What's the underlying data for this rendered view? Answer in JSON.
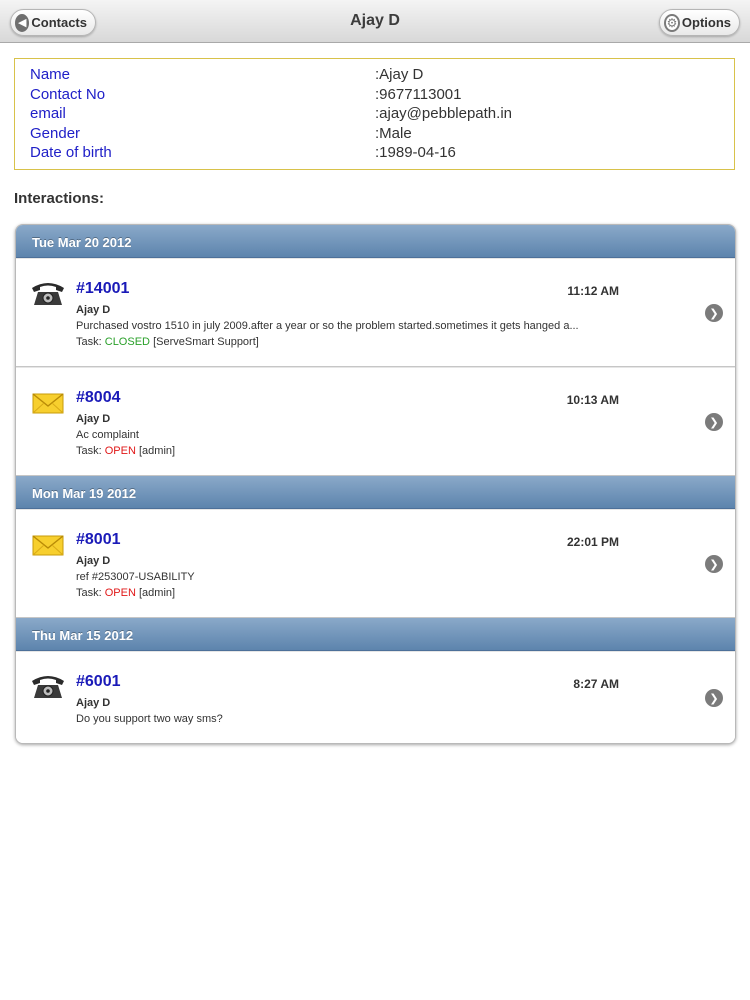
{
  "navbar": {
    "back_label": "Contacts",
    "title": "Ajay D",
    "options_label": "Options"
  },
  "contact": {
    "fields": [
      {
        "label": "Name",
        "value": ":Ajay D"
      },
      {
        "label": "Contact No",
        "value": ":9677113001"
      },
      {
        "label": "email",
        "value": ":ajay@pebblepath.in"
      },
      {
        "label": "Gender",
        "value": ":Male"
      },
      {
        "label": "Date of birth",
        "value": ":1989-04-16"
      }
    ]
  },
  "interactions_title": "Interactions:",
  "groups": [
    {
      "date": "Tue Mar 20 2012",
      "items": [
        {
          "icon": "telephone-icon",
          "id": "#14001",
          "time": "11:12 AM",
          "name": "Ajay D",
          "desc": "Purchased vostro 1510 in july 2009.after a year or so the problem started.sometimes it gets hanged a...",
          "task_prefix": "Task:",
          "status": "CLOSED",
          "assignee": "[ServeSmart Support]"
        },
        {
          "icon": "envelope-icon",
          "id": "#8004",
          "time": "10:13 AM",
          "name": "Ajay D",
          "desc": "Ac complaint",
          "task_prefix": "Task:",
          "status": "OPEN",
          "assignee": "[admin]"
        }
      ]
    },
    {
      "date": "Mon Mar 19 2012",
      "items": [
        {
          "icon": "envelope-icon",
          "id": "#8001",
          "time": "22:01 PM",
          "name": "Ajay D",
          "desc": "ref #253007-USABILITY",
          "task_prefix": "Task:",
          "status": "OPEN",
          "assignee": "[admin]"
        }
      ]
    },
    {
      "date": "Thu Mar 15 2012",
      "items": [
        {
          "icon": "telephone-icon",
          "id": "#6001",
          "time": "8:27 AM",
          "name": "Ajay D",
          "desc": "Do you support two way sms?"
        }
      ]
    }
  ],
  "colors": {
    "link_blue": "#1a1ab8",
    "label_blue": "#2020c8",
    "closed_green": "#2aa02a",
    "open_red": "#e01818",
    "header_blue": "#5d84ad",
    "info_border": "#d8c24a"
  }
}
